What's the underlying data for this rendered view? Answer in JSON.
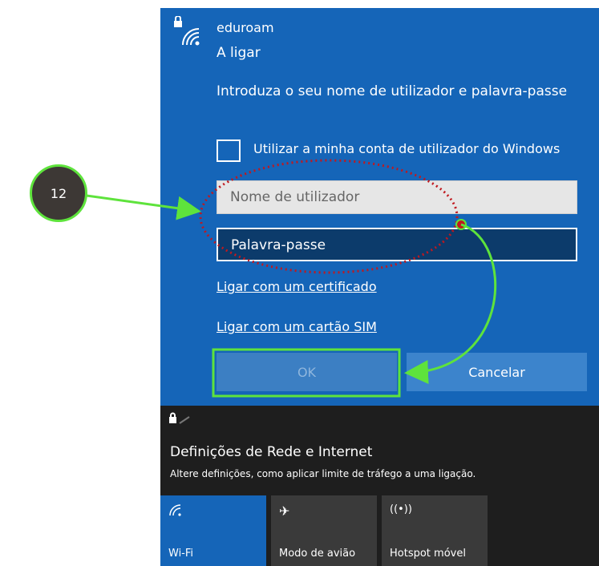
{
  "network": {
    "ssid": "eduroam",
    "status": "A ligar",
    "prompt": "Introduza o seu nome de utilizador e palavra-passe",
    "checkbox_label": "Utilizar a minha conta de utilizador do Windows",
    "username_placeholder": "Nome de utilizador",
    "password_placeholder": "Palavra-passe",
    "link_certificate": "Ligar com um certificado",
    "link_sim": "Ligar com um cartão SIM",
    "ok_label": "OK",
    "cancel_label": "Cancelar"
  },
  "settings": {
    "title": "Definições de Rede e Internet",
    "subtitle": "Altere definições, como aplicar limite de tráfego a uma ligação."
  },
  "tiles": [
    {
      "label": "Wi-Fi",
      "icon": "wifi-icon"
    },
    {
      "label": "Modo de avião",
      "icon": "airplane-icon"
    },
    {
      "label": "Hotspot móvel",
      "icon": "hotspot-icon"
    }
  ],
  "annotation": {
    "number": "12",
    "accent_color": "#5ee33c",
    "ellipse_color": "#c0181e"
  }
}
